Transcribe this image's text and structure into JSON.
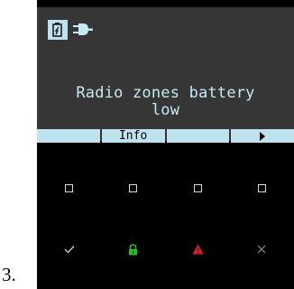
{
  "list_marker": "3.",
  "screen": {
    "message_line1": "Radio zones battery",
    "message_line2": "low",
    "softkeys": [
      "",
      "Info",
      "",
      ""
    ]
  },
  "icons": {
    "status": [
      "device-battery-icon",
      "power-plug-icon"
    ],
    "softkey_right": "arrow-right-icon",
    "keypad_leds": [
      "square-led-icon",
      "square-led-icon",
      "square-led-icon",
      "square-led-icon"
    ],
    "status_row": [
      "check-icon",
      "lock-icon",
      "warning-icon",
      "close-icon"
    ]
  },
  "colors": {
    "screen_bg": "#363636",
    "screen_text": "#c6e9f2",
    "softkey_bg": "#bfe3ee",
    "lock_green": "#22c41f",
    "warning_red": "#e02020",
    "check_gray": "#c8c8c8",
    "close_gray": "#7a7a7a"
  }
}
